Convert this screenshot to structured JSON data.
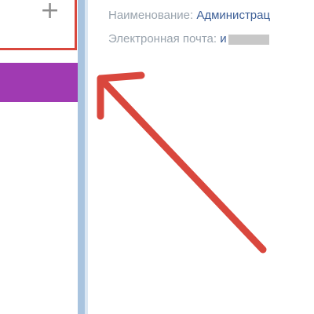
{
  "add_panel": {
    "plus_symbol": "+",
    "plus_icon": "plus-icon"
  },
  "info": {
    "name_label": "Наименование:",
    "name_value": "Администрац",
    "email_label": "Электронная почта:",
    "email_value_start": "и"
  },
  "colors": {
    "highlight_red": "#d9473d",
    "selected_item_purple": "#a03ab2",
    "divider_blue": "#a9c4df",
    "link_blue": "#3c5e96"
  }
}
